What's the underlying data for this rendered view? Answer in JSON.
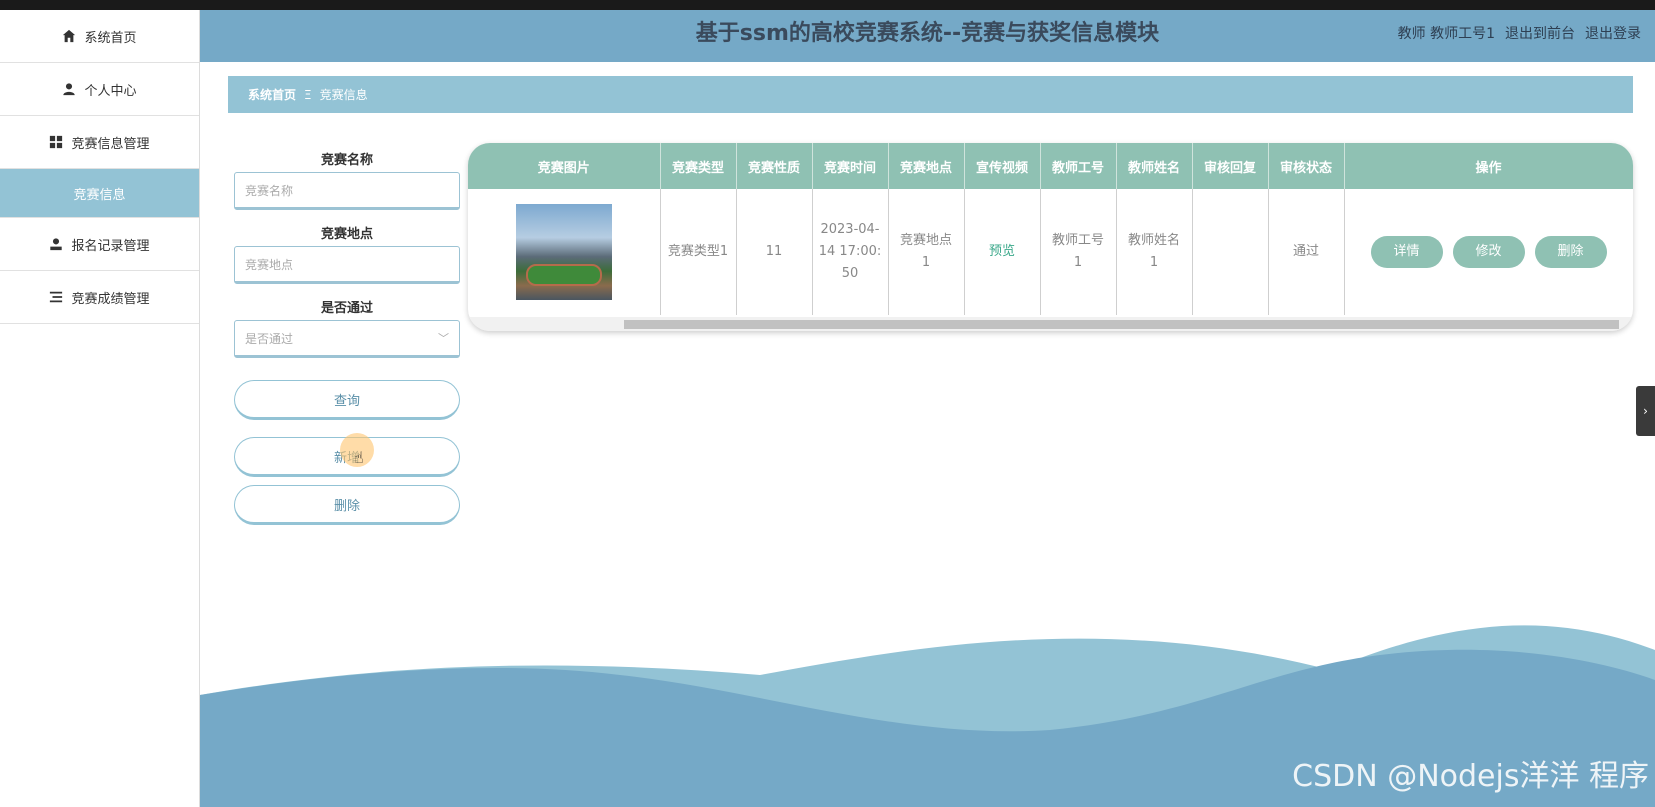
{
  "app_title": "基于ssm的高校竞赛系统--竞赛与获奖信息模块",
  "header": {
    "user_text": "教师 教师工号1",
    "to_front": "退出到前台",
    "logout": "退出登录"
  },
  "sidebar": {
    "items": [
      {
        "label": "系统首页",
        "icon": "home-icon"
      },
      {
        "label": "个人中心",
        "icon": "user-icon"
      },
      {
        "label": "竞赛信息管理",
        "icon": "grid-icon"
      },
      {
        "label": "竞赛信息",
        "icon": ""
      },
      {
        "label": "报名记录管理",
        "icon": "user-icon"
      },
      {
        "label": "竞赛成绩管理",
        "icon": "list-icon"
      }
    ]
  },
  "breadcrumb": {
    "home": "系统首页",
    "sep": "Ξ",
    "current": "竞赛信息"
  },
  "search": {
    "name_label": "竞赛名称",
    "name_placeholder": "竞赛名称",
    "place_label": "竞赛地点",
    "place_placeholder": "竞赛地点",
    "pass_label": "是否通过",
    "pass_placeholder": "是否通过",
    "query_btn": "查询",
    "add_btn": "新增",
    "delete_btn": "删除"
  },
  "table": {
    "headers": [
      "竞赛图片",
      "竞赛类型",
      "竞赛性质",
      "竞赛时间",
      "竞赛地点",
      "宣传视频",
      "教师工号",
      "教师姓名",
      "审核回复",
      "审核状态",
      "操作"
    ],
    "rows": [
      {
        "type": "竞赛类型1",
        "nature": "11",
        "time": "2023-04-14 17:00:50",
        "place": "竞赛地点1",
        "video": "预览",
        "teacher_id": "教师工号1",
        "teacher_name": "教师姓名1",
        "reply": "",
        "status": "通过",
        "ops": [
          "详情",
          "修改",
          "删除"
        ]
      }
    ]
  },
  "side_tab": "›",
  "watermark": "CSDN @Nodejs洋洋 程序",
  "colors": {
    "header": "#75a9c7",
    "accent": "#93c3d5",
    "table_header": "#8fc1b3"
  }
}
